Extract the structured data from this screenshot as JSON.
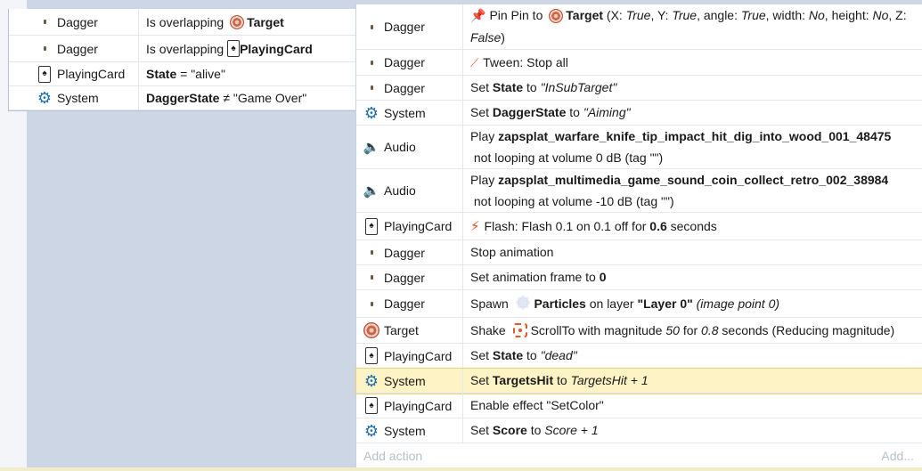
{
  "conditions": [
    {
      "object": "Dagger",
      "icon": "dagger-icon",
      "parts": [
        {
          "t": "Is overlapping "
        },
        {
          "icon": "target-icon"
        },
        {
          "t": "Target",
          "b": true
        }
      ]
    },
    {
      "object": "Dagger",
      "icon": "dagger-icon",
      "parts": [
        {
          "t": "Is overlapping "
        },
        {
          "icon": "playing-card-icon"
        },
        {
          "t": "PlayingCard",
          "b": true
        }
      ]
    },
    {
      "object": "PlayingCard",
      "icon": "playing-card-icon",
      "parts": [
        {
          "t": "State",
          "b": true
        },
        {
          "t": " = \"alive\""
        }
      ]
    },
    {
      "object": "System",
      "icon": "gear-icon",
      "parts": [
        {
          "t": "DaggerState",
          "b": true
        },
        {
          "t": " ≠ \"Game Over\""
        }
      ]
    }
  ],
  "actions": [
    {
      "object": "Dagger",
      "icon": "dagger-icon",
      "parts": [
        {
          "icon": "pin-icon"
        },
        {
          "t": "Pin Pin to "
        },
        {
          "icon": "target-icon"
        },
        {
          "t": "Target",
          "b": true
        },
        {
          "t": " (X: "
        },
        {
          "t": "True",
          "i": true
        },
        {
          "t": ", Y: "
        },
        {
          "t": "True",
          "i": true
        },
        {
          "t": ", angle: "
        },
        {
          "t": "True",
          "i": true
        },
        {
          "t": ", width: "
        },
        {
          "t": "No",
          "i": true
        },
        {
          "t": ", height: "
        },
        {
          "t": "No",
          "i": true
        },
        {
          "t": ", Z: "
        },
        {
          "t": "False",
          "i": true
        },
        {
          "t": ")"
        }
      ]
    },
    {
      "object": "Dagger",
      "icon": "dagger-icon",
      "parts": [
        {
          "icon": "tween-icon"
        },
        {
          "t": "Tween: Stop all"
        }
      ]
    },
    {
      "object": "Dagger",
      "icon": "dagger-icon",
      "parts": [
        {
          "t": "Set "
        },
        {
          "t": "State",
          "b": true
        },
        {
          "t": " to "
        },
        {
          "t": "\"InSubTarget\"",
          "i": true
        }
      ]
    },
    {
      "object": "System",
      "icon": "gear-icon",
      "parts": [
        {
          "t": "Set "
        },
        {
          "t": "DaggerState",
          "b": true
        },
        {
          "t": " to "
        },
        {
          "t": "\"Aiming\"",
          "i": true
        }
      ]
    },
    {
      "object": "Audio",
      "icon": "speaker-icon",
      "parts": [
        {
          "t": "Play "
        },
        {
          "t": "zapsplat_warfare_knife_tip_impact_hit_dig_into_wood_001_48475",
          "b": true
        },
        {
          "t": " not looping at volume 0 dB (tag \"\")"
        }
      ]
    },
    {
      "object": "Audio",
      "icon": "speaker-icon",
      "parts": [
        {
          "t": "Play "
        },
        {
          "t": "zapsplat_multimedia_game_sound_coin_collect_retro_002_38984",
          "b": true
        },
        {
          "t": " not looping at volume -10 dB (tag \"\")"
        }
      ]
    },
    {
      "object": "PlayingCard",
      "icon": "playing-card-icon",
      "parts": [
        {
          "icon": "flash-icon"
        },
        {
          "t": "Flash: Flash 0.1 on 0.1 off for "
        },
        {
          "t": "0.6",
          "b": true
        },
        {
          "t": " seconds"
        }
      ]
    },
    {
      "object": "Dagger",
      "icon": "dagger-icon",
      "parts": [
        {
          "t": "Stop animation"
        }
      ]
    },
    {
      "object": "Dagger",
      "icon": "dagger-icon",
      "parts": [
        {
          "t": "Set animation frame to "
        },
        {
          "t": "0",
          "b": true
        }
      ]
    },
    {
      "object": "Dagger",
      "icon": "dagger-icon",
      "parts": [
        {
          "t": "Spawn "
        },
        {
          "icon": "particles-icon"
        },
        {
          "t": "Particles",
          "b": true
        },
        {
          "t": " on layer "
        },
        {
          "t": "\"Layer 0\"",
          "b": true
        },
        {
          "t": " "
        },
        {
          "t": "(image point 0)",
          "i": true
        }
      ]
    },
    {
      "object": "Target",
      "icon": "target-icon",
      "parts": [
        {
          "t": "Shake "
        },
        {
          "icon": "scrollto-icon"
        },
        {
          "t": "ScrollTo with magnitude "
        },
        {
          "t": "50",
          "i": true
        },
        {
          "t": " for "
        },
        {
          "t": "0.8",
          "i": true
        },
        {
          "t": " seconds (Reducing magnitude)"
        }
      ]
    },
    {
      "object": "PlayingCard",
      "icon": "playing-card-icon",
      "parts": [
        {
          "t": "Set "
        },
        {
          "t": "State",
          "b": true
        },
        {
          "t": " to "
        },
        {
          "t": "\"dead\"",
          "i": true
        }
      ]
    },
    {
      "object": "System",
      "icon": "gear-icon",
      "highlighted": true,
      "parts": [
        {
          "t": "Set "
        },
        {
          "t": "TargetsHit",
          "b": true
        },
        {
          "t": " to "
        },
        {
          "t": "TargetsHit + 1",
          "i": true
        }
      ]
    },
    {
      "object": "PlayingCard",
      "icon": "playing-card-icon",
      "parts": [
        {
          "t": "Enable effect \"SetColor\""
        }
      ]
    },
    {
      "object": "System",
      "icon": "gear-icon",
      "parts": [
        {
          "t": "Set "
        },
        {
          "t": "Score",
          "b": true
        },
        {
          "t": " to "
        },
        {
          "t": "Score + 1",
          "i": true
        }
      ]
    }
  ],
  "footer": {
    "add_action": "Add action",
    "add_more": "Add..."
  },
  "colors": {
    "highlight": "#fdf3c4",
    "event_bg": "#cdd6e4",
    "system_blue": "#1f6fb5"
  }
}
